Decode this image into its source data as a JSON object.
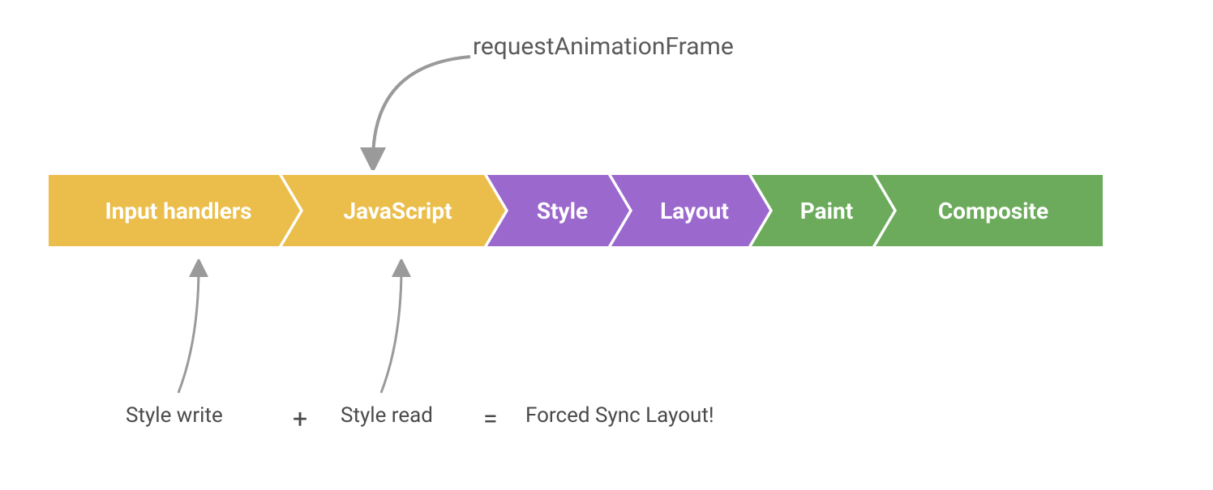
{
  "top_annotation": "requestAnimationFrame",
  "stages": {
    "input_handlers": "Input handlers",
    "javascript": "JavaScript",
    "style": "Style",
    "layout": "Layout",
    "paint": "Paint",
    "composite": "Composite"
  },
  "bottom": {
    "style_write": "Style write",
    "plus": "+",
    "style_read": "Style read",
    "equals": "=",
    "forced": "Forced Sync Layout!"
  },
  "colors": {
    "yellow": "#ebbe4b",
    "purple": "#9b68ce",
    "green": "#6bab5b",
    "arrow": "#9a9a9a",
    "text_dark": "#4a4a4a"
  }
}
